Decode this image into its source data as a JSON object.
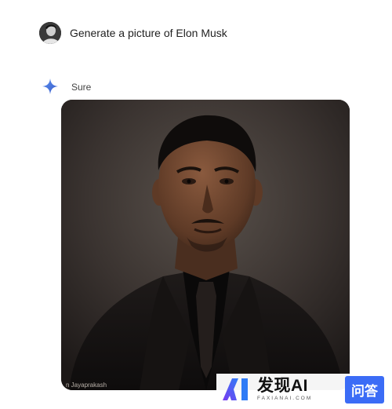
{
  "chat": {
    "user_prompt": "Generate a picture of Elon Musk",
    "assistant_reply": "Sure",
    "image_credit": "n Jayaprakash"
  },
  "watermark": {
    "brand_name": "发现AI",
    "brand_sub": "FAXIANAI.COM",
    "qa_label": "问答"
  },
  "icons": {
    "user": "user-avatar",
    "assistant": "sparkle-icon",
    "logo": "ai-logo-icon"
  },
  "colors": {
    "sparkle": "#4a7bd8",
    "qa_badge": "#3b6cf6"
  }
}
